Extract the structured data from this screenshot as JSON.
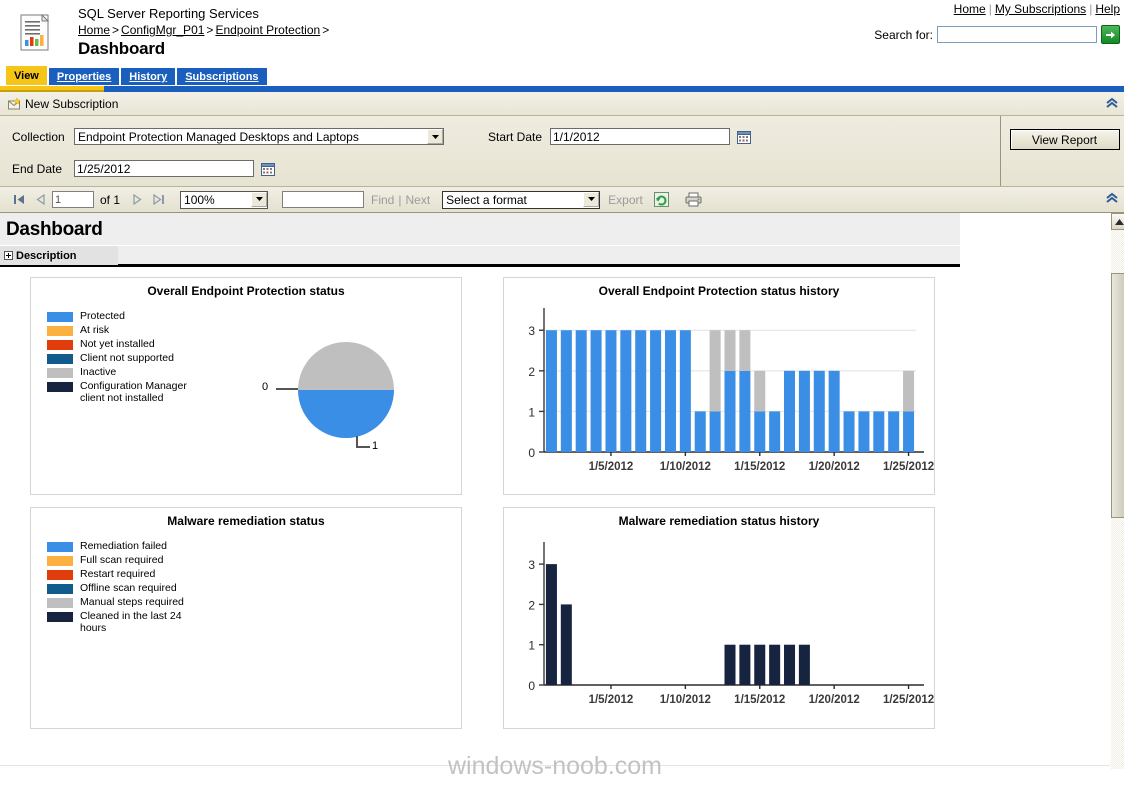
{
  "header": {
    "app_title": "SQL Server Reporting Services",
    "breadcrumb": [
      {
        "label": "Home",
        "link": true
      },
      {
        "label": ">",
        "link": false
      },
      {
        "label": "ConfigMgr_P01",
        "link": true
      },
      {
        "label": ">",
        "link": false
      },
      {
        "label": "Endpoint Protection",
        "link": true
      },
      {
        "label": ">",
        "link": false
      }
    ],
    "page_title": "Dashboard",
    "links": [
      {
        "label": "Home"
      },
      {
        "label": "My Subscriptions"
      },
      {
        "label": "Help"
      }
    ],
    "link_separator": "|",
    "search_label": "Search for:",
    "search_value": "",
    "search_placeholder": "",
    "search_go_icon": "arrow-right-icon",
    "logo_icon": "report-document-icon"
  },
  "tabs": [
    {
      "label": "View",
      "active": true
    },
    {
      "label": "Properties",
      "active": false
    },
    {
      "label": "History",
      "active": false
    },
    {
      "label": "Subscriptions",
      "active": false
    }
  ],
  "subscription_bar": {
    "label": "New Subscription",
    "icon": "new-subscription-envelope-icon",
    "collapse_icon": "chevron-double-up-icon"
  },
  "parameters": {
    "collection_label": "Collection",
    "collection_value": "Endpoint Protection Managed Desktops and Laptops",
    "start_date_label": "Start Date",
    "start_date_value": "1/1/2012",
    "end_date_label": "End Date",
    "end_date_value": "1/25/2012",
    "calendar_icon": "calendar-icon",
    "dropdown_icon": "chevron-down-icon",
    "view_report_label": "View Report"
  },
  "report_toolbar": {
    "first_page_icon": "first-page-icon",
    "prev_page_icon": "previous-page-icon",
    "page_value": "1",
    "of_label": "of 1",
    "next_page_icon": "next-page-icon",
    "last_page_icon": "last-page-icon",
    "zoom_value": "100%",
    "find_value": "",
    "find_label": "Find",
    "find_separator": "|",
    "next_label": "Next",
    "format_value": "Select a format",
    "export_label": "Export",
    "refresh_icon": "refresh-icon",
    "print_icon": "print-icon",
    "collapse_icon": "chevron-double-up-icon"
  },
  "report": {
    "title": "Dashboard",
    "description_label": "Description",
    "description_expander_icon": "plus-box-icon"
  },
  "watermark": "windows-noob.com",
  "colors": {
    "series_protected": "#3a8ee6",
    "series_at_risk": "#fcb040",
    "series_not_installed": "#e03c0c",
    "series_not_supported": "#115c8c",
    "series_inactive": "#bfbfbf",
    "series_cm_client_missing": "#16243f",
    "tab_active": "#f5c518",
    "tab_inactive": "#1b5fbe",
    "panel_bg": "#ece9d8",
    "accent_green": "#1f8b2d"
  },
  "chart_data": [
    {
      "type": "pie",
      "title": "Overall Endpoint Protection status",
      "legend_position": "left",
      "labels": [
        "Protected",
        "At risk",
        "Not yet installed",
        "Client not supported",
        "Inactive",
        "Configuration Manager client not installed"
      ],
      "colors": [
        "#3a8ee6",
        "#fcb040",
        "#e03c0c",
        "#115c8c",
        "#bfbfbf",
        "#16243f"
      ],
      "values": [
        1,
        0,
        0,
        0,
        1,
        0
      ],
      "slices": [
        {
          "label": "Protected",
          "value": 1,
          "color": "#3a8ee6",
          "data_label": "1",
          "share_pct": 50
        },
        {
          "label": "Inactive",
          "value": 1,
          "color": "#bfbfbf",
          "data_label": "0",
          "share_pct": 50
        }
      ],
      "data_labels": [
        "0",
        "1"
      ]
    },
    {
      "type": "bar",
      "stacked": true,
      "title": "Overall Endpoint Protection status history",
      "xlabel": "",
      "ylabel": "",
      "ylim": [
        0,
        3.4
      ],
      "yticks": [
        0,
        1,
        2,
        3
      ],
      "grid": true,
      "x": [
        "1/1/2012",
        "1/2/2012",
        "1/3/2012",
        "1/4/2012",
        "1/5/2012",
        "1/6/2012",
        "1/7/2012",
        "1/8/2012",
        "1/9/2012",
        "1/10/2012",
        "1/11/2012",
        "1/12/2012",
        "1/13/2012",
        "1/14/2012",
        "1/15/2012",
        "1/16/2012",
        "1/17/2012",
        "1/18/2012",
        "1/19/2012",
        "1/20/2012",
        "1/21/2012",
        "1/22/2012",
        "1/23/2012",
        "1/24/2012",
        "1/25/2012"
      ],
      "tick_labels": [
        "1/5/2012",
        "1/10/2012",
        "1/15/2012",
        "1/20/2012",
        "1/25/2012"
      ],
      "tick_indices": [
        4,
        9,
        14,
        19,
        24
      ],
      "series": [
        {
          "name": "Protected",
          "color": "#3a8ee6",
          "values": [
            3,
            3,
            3,
            3,
            3,
            3,
            3,
            3,
            3,
            3,
            1,
            1,
            2,
            2,
            1,
            1,
            2,
            2,
            2,
            2,
            1,
            1,
            1,
            1,
            1
          ]
        },
        {
          "name": "Inactive",
          "color": "#bfbfbf",
          "values": [
            0,
            0,
            0,
            0,
            0,
            0,
            0,
            0,
            0,
            0,
            0,
            2,
            1,
            1,
            1,
            0,
            0,
            0,
            0,
            0,
            0,
            0,
            0,
            0,
            1
          ]
        }
      ]
    },
    {
      "type": "pie",
      "title": "Malware remediation status",
      "legend_position": "left",
      "labels": [
        "Remediation failed",
        "Full scan required",
        "Restart required",
        "Offline scan required",
        "Manual steps required",
        "Cleaned in the last 24 hours"
      ],
      "colors": [
        "#3a8ee6",
        "#fcb040",
        "#e03c0c",
        "#115c8c",
        "#bfbfbf",
        "#16243f"
      ],
      "values": [
        0,
        0,
        0,
        0,
        0,
        0
      ],
      "slices": [],
      "data_labels": []
    },
    {
      "type": "bar",
      "stacked": false,
      "title": "Malware remediation status history",
      "xlabel": "",
      "ylabel": "",
      "ylim": [
        0,
        3.4
      ],
      "yticks": [
        0,
        1,
        2,
        3
      ],
      "grid": false,
      "x": [
        "1/1/2012",
        "1/2/2012",
        "1/3/2012",
        "1/4/2012",
        "1/5/2012",
        "1/6/2012",
        "1/7/2012",
        "1/8/2012",
        "1/9/2012",
        "1/10/2012",
        "1/11/2012",
        "1/12/2012",
        "1/13/2012",
        "1/14/2012",
        "1/15/2012",
        "1/16/2012",
        "1/17/2012",
        "1/18/2012",
        "1/19/2012",
        "1/20/2012",
        "1/21/2012",
        "1/22/2012",
        "1/23/2012",
        "1/24/2012",
        "1/25/2012"
      ],
      "tick_labels": [
        "1/5/2012",
        "1/10/2012",
        "1/15/2012",
        "1/20/2012",
        "1/25/2012"
      ],
      "tick_indices": [
        4,
        9,
        14,
        19,
        24
      ],
      "series": [
        {
          "name": "Cleaned in the last 24 hours",
          "color": "#16243f",
          "values": [
            3,
            2,
            0,
            0,
            0,
            0,
            0,
            0,
            0,
            0,
            0,
            0,
            1,
            1,
            1,
            1,
            1,
            1,
            0,
            0,
            0,
            0,
            0,
            0,
            0
          ]
        }
      ]
    }
  ]
}
